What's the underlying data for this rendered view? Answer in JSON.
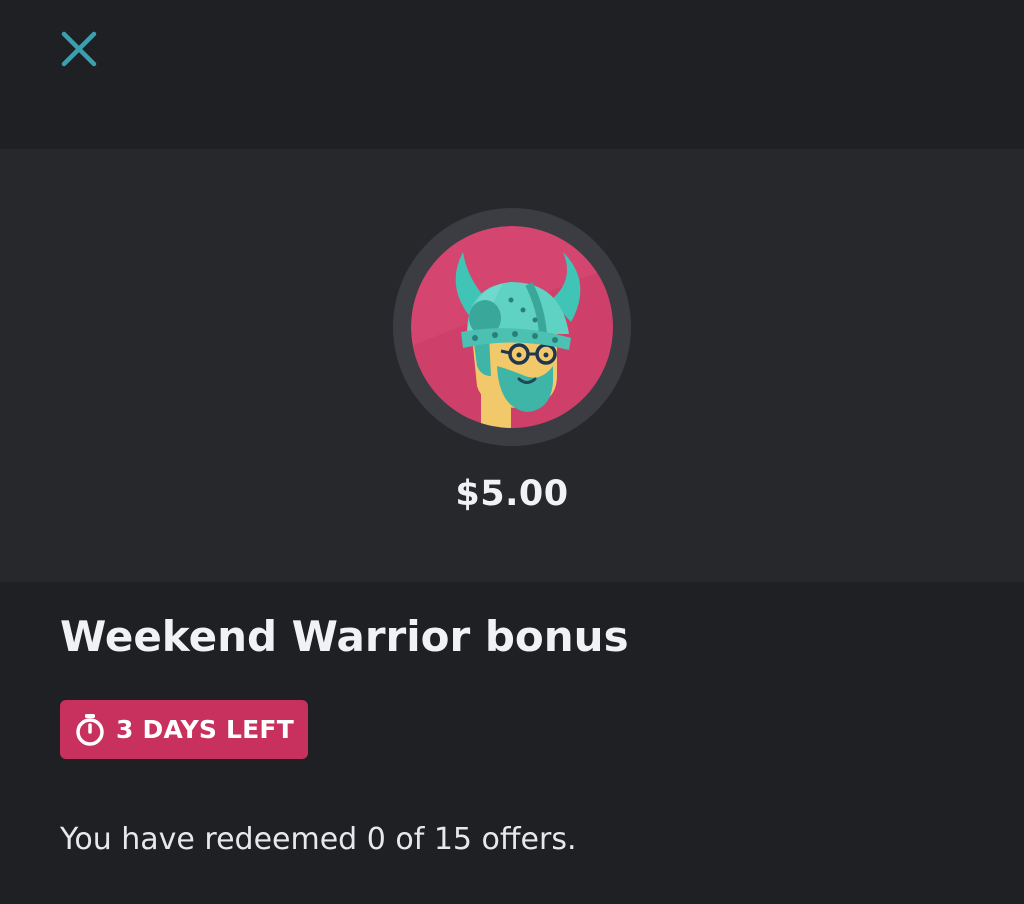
{
  "header": {
    "close_icon": "close-x-icon",
    "accent_color": "#3aa0b0"
  },
  "badge": {
    "icon": "viking-warrior-avatar",
    "amount": "$5.00",
    "background_color": "#d4456f"
  },
  "offer": {
    "title": "Weekend Warrior bonus",
    "time_left_icon": "stopwatch-icon",
    "time_left_label": "3 DAYS LEFT",
    "time_left_color": "#c8305e",
    "progress_text": "You have redeemed 0 of 15 offers.",
    "redeemed": 0,
    "total": 15
  }
}
